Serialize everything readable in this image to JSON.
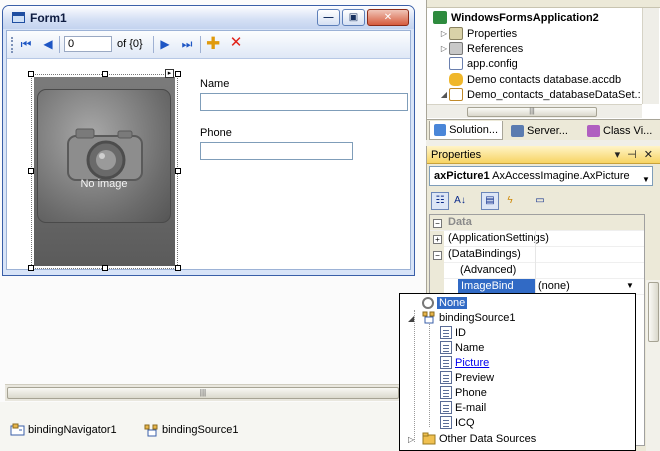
{
  "form": {
    "title": "Form1",
    "controls": {
      "minimize": "—",
      "maximize": "▣",
      "close": "✕"
    }
  },
  "navigator": {
    "position": "0",
    "count": "of {0}"
  },
  "picture": {
    "placeholder_text": "No image"
  },
  "fields": {
    "name_label": "Name",
    "phone_label": "Phone",
    "name_value": "",
    "phone_value": ""
  },
  "tray": {
    "items": [
      {
        "label": "bindingNavigator1",
        "icon": "binding-navigator-icon"
      },
      {
        "label": "bindingSource1",
        "icon": "binding-source-icon"
      }
    ]
  },
  "solution_explorer": {
    "items": [
      {
        "label": "WindowsFormsApplication2",
        "icon": "csharp-project-icon",
        "bold": true
      },
      {
        "label": "Properties",
        "icon": "properties-folder-icon"
      },
      {
        "label": "References",
        "icon": "references-folder-icon"
      },
      {
        "label": "app.config",
        "icon": "config-file-icon"
      },
      {
        "label": "Demo contacts database.accdb",
        "icon": "access-database-icon"
      },
      {
        "label": "Demo_contacts_databaseDataSet.:",
        "icon": "dataset-icon"
      }
    ],
    "tabs": [
      {
        "label": "Solution...",
        "icon": "solution-explorer-icon"
      },
      {
        "label": "Server...",
        "icon": "server-explorer-icon"
      },
      {
        "label": "Class Vi...",
        "icon": "class-view-icon"
      }
    ]
  },
  "properties": {
    "title": "Properties",
    "title_buttons": "▾ ⊣ ✕",
    "object_name": "axPicture1",
    "object_type": "AxAccessImagine.AxPicture",
    "category": "Data",
    "rows": [
      {
        "name": "(ApplicationSettings)",
        "value": ""
      },
      {
        "name": "(DataBindings)",
        "value": ""
      },
      {
        "name": "(Advanced)",
        "value": ""
      },
      {
        "name": "ImageBind",
        "value": "(none)"
      }
    ]
  },
  "binding_popup": {
    "none": "None",
    "source": "bindingSource1",
    "fields": [
      "ID",
      "Name",
      "Picture",
      "Preview",
      "Phone",
      "E-mail",
      "ICQ"
    ],
    "link_field": "Picture",
    "other": "Other Data Sources"
  },
  "colors": {
    "selection": "#316ac5",
    "title_blue": "#3a5fa8",
    "nav_blue": "#1e56c4",
    "add_orange": "#e09a0c",
    "delete_red": "#e0221a",
    "properties_title": "#f7d463"
  }
}
